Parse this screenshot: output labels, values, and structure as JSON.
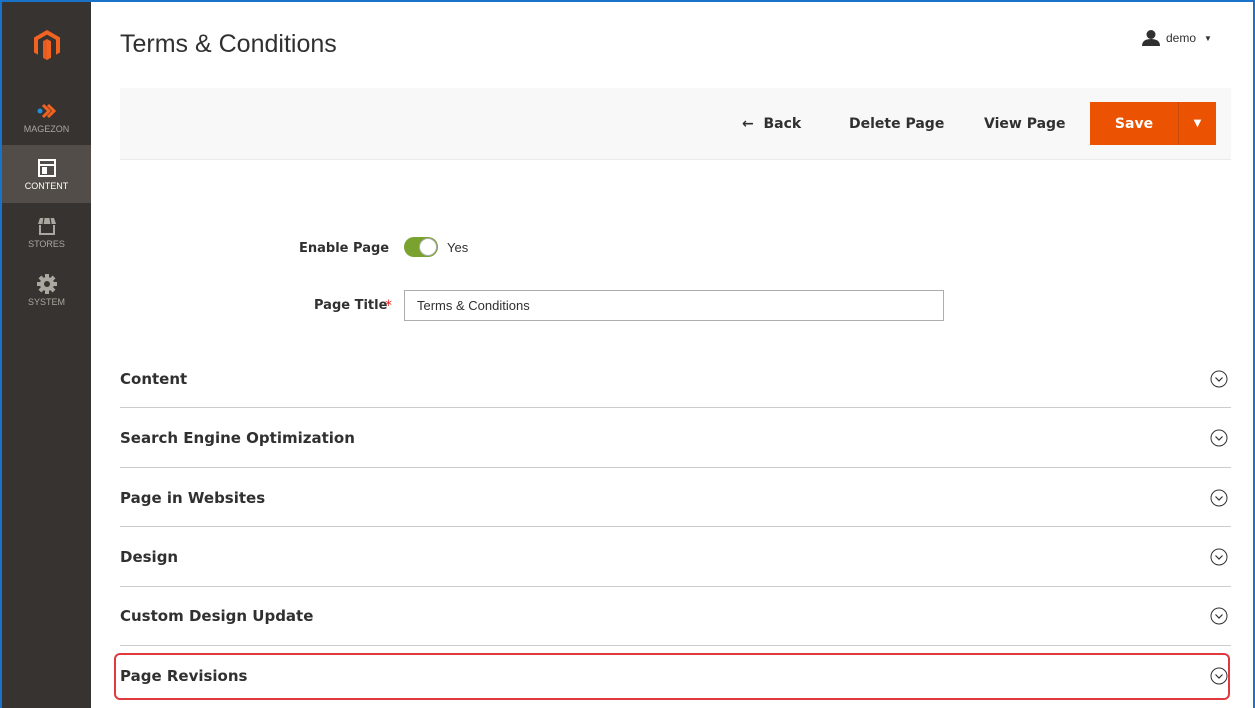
{
  "sidebar": {
    "items": [
      {
        "label": "MAGEZON",
        "icon": "magezon-chevrons-icon"
      },
      {
        "label": "CONTENT",
        "icon": "content-layout-icon",
        "active": true
      },
      {
        "label": "STORES",
        "icon": "store-icon"
      },
      {
        "label": "SYSTEM",
        "icon": "gear-icon"
      }
    ]
  },
  "header": {
    "title": "Terms & Conditions",
    "user": "demo"
  },
  "actions": {
    "back": "Back",
    "delete": "Delete Page",
    "view": "View Page",
    "save": "Save"
  },
  "form": {
    "enable_label": "Enable Page",
    "enable_value": "Yes",
    "title_label": "Page Title",
    "title_value": "Terms & Conditions"
  },
  "sections": [
    {
      "title": "Content"
    },
    {
      "title": "Search Engine Optimization"
    },
    {
      "title": "Page in Websites"
    },
    {
      "title": "Design"
    },
    {
      "title": "Custom Design Update"
    },
    {
      "title": "Page Revisions"
    }
  ],
  "colors": {
    "accent": "#eb5202",
    "sidebar": "#373330",
    "toggle_on": "#79a22e",
    "highlight": "#e0393e"
  }
}
